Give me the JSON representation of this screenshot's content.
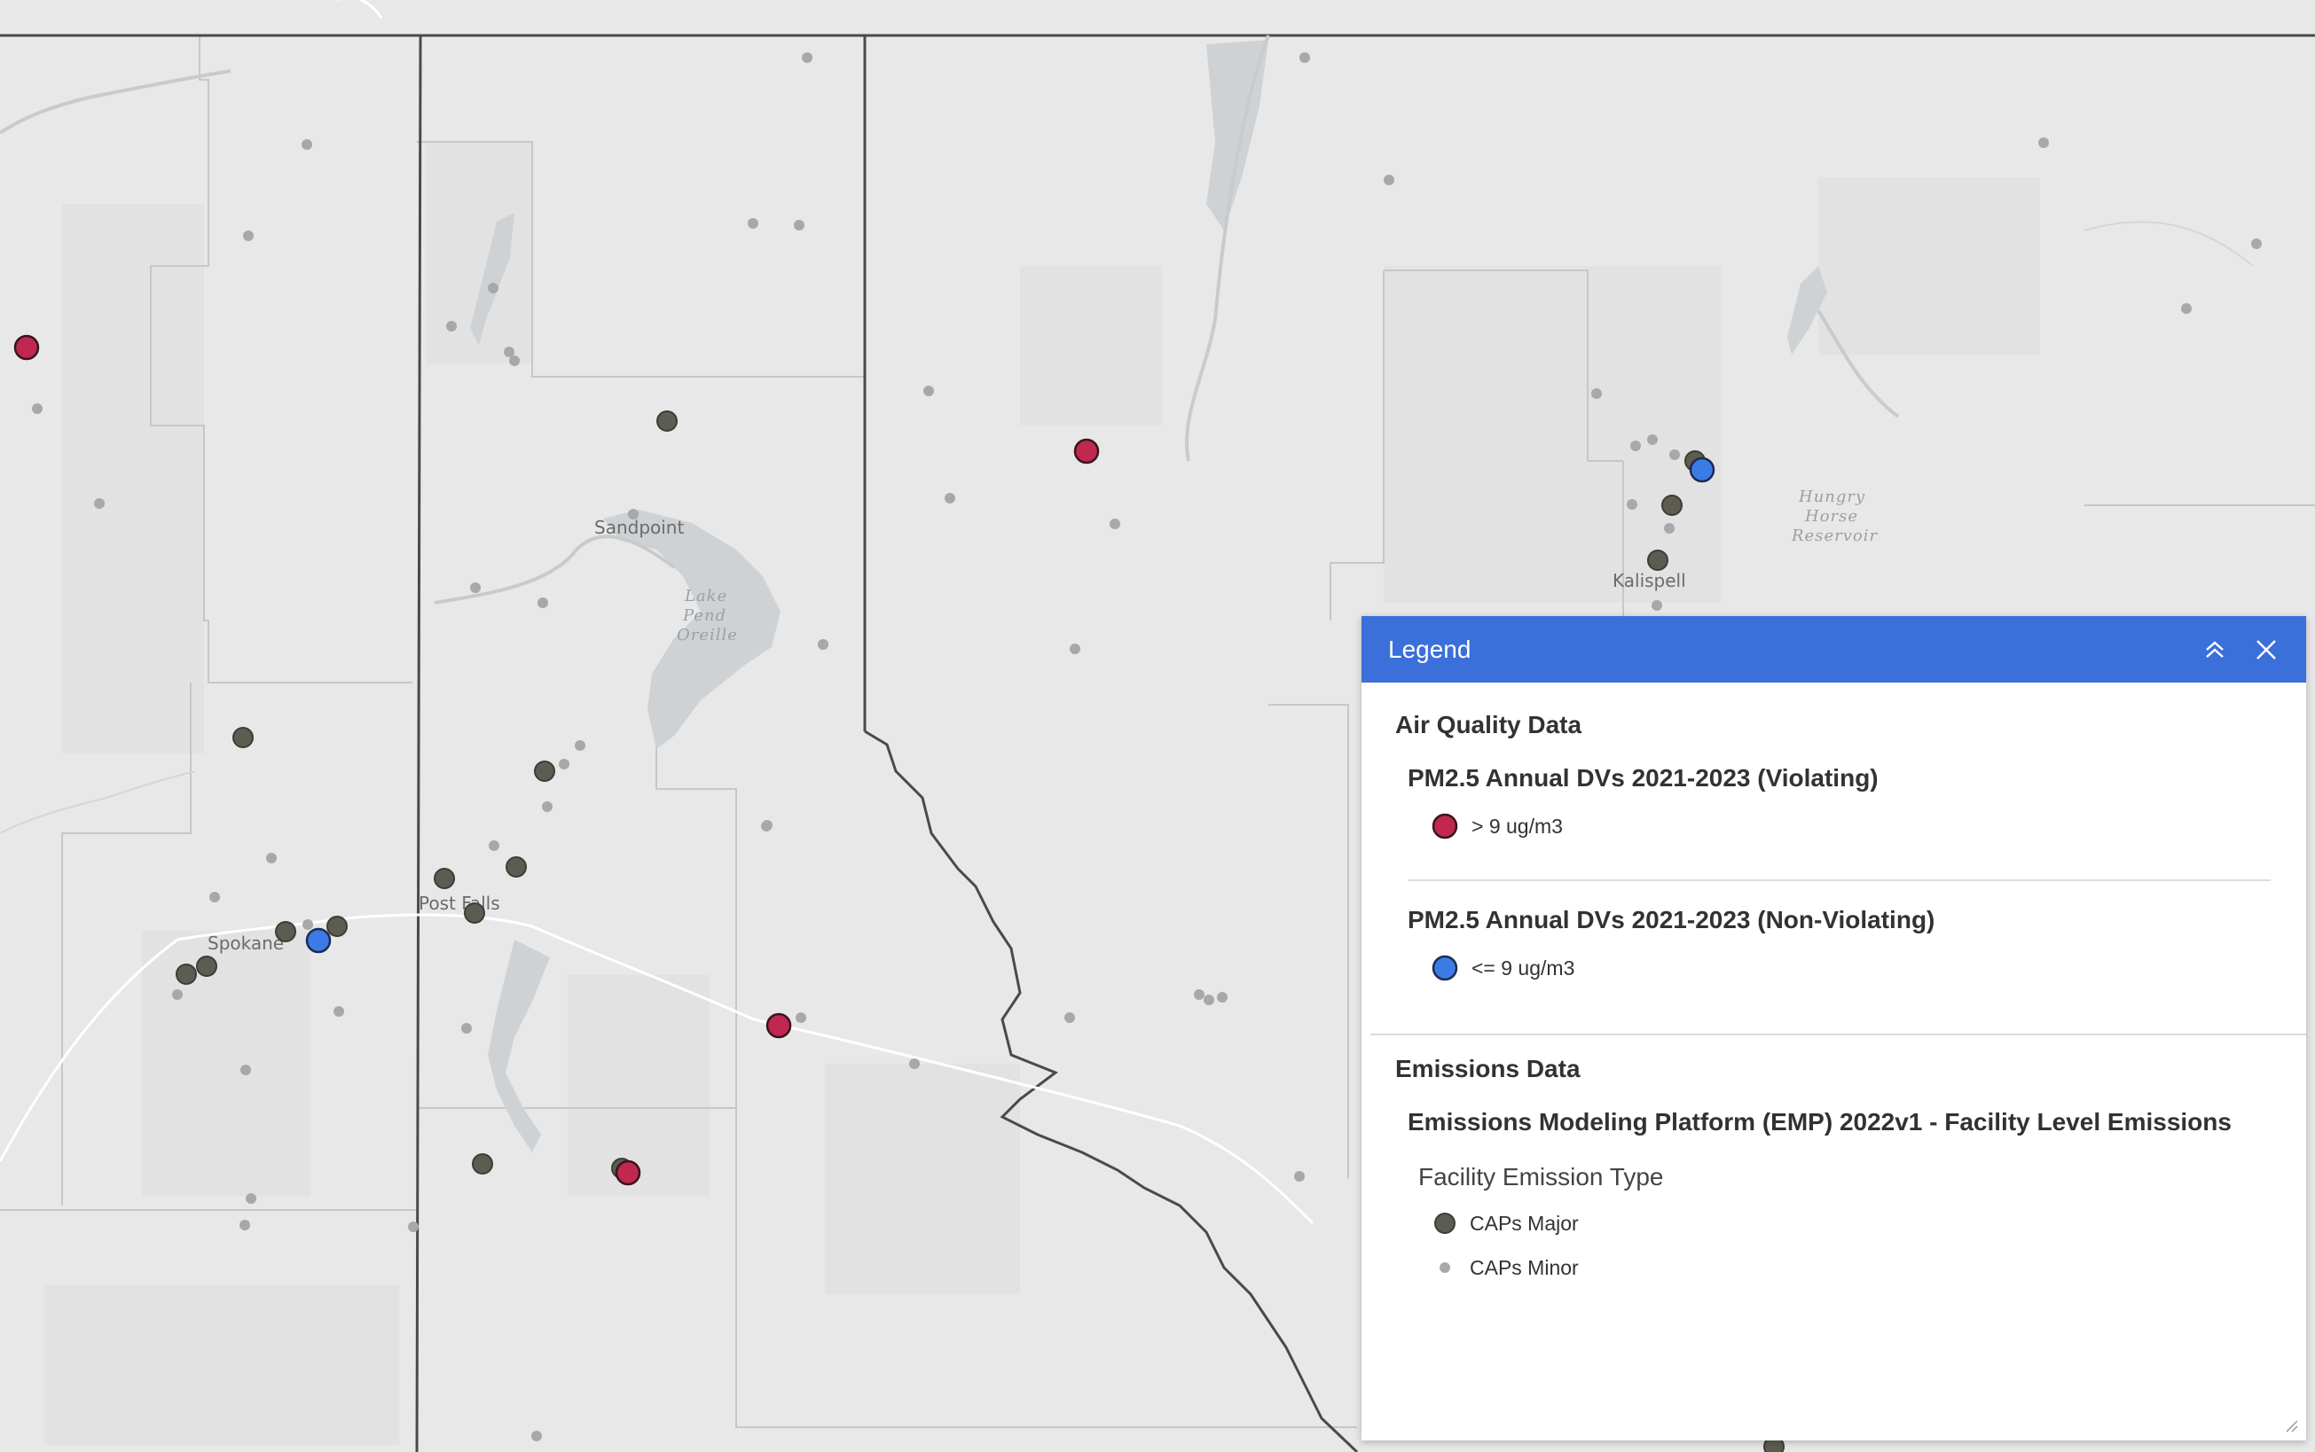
{
  "map": {
    "places": [
      "Sandpoint",
      "Post Falls",
      "Spokane",
      "Kalispell"
    ],
    "water_labels": {
      "lake_pend_oreille": [
        "Lake",
        "Pend",
        "Oreille"
      ],
      "hungry_horse": [
        "Hungry",
        "Horse",
        "Reservoir"
      ]
    }
  },
  "legend": {
    "title": "Legend",
    "sections": {
      "air_quality": {
        "title": "Air Quality Data",
        "violating": {
          "title": "PM2.5 Annual DVs 2021-2023 (Violating)",
          "label": "> 9 ug/m3",
          "color": "#c0284f"
        },
        "non_violating": {
          "title": "PM2.5 Annual DVs 2021-2023 (Non-Violating)",
          "label": "<= 9 ug/m3",
          "color": "#3c7be6"
        }
      },
      "emissions": {
        "title": "Emissions Data",
        "layer_title": "Emissions Modeling Platform (EMP) 2022v1 - Facility Level Emissions",
        "field_title": "Facility Emission Type",
        "major": {
          "label": "CAPs Major",
          "color": "#5c5c52"
        },
        "minor": {
          "label": "CAPs Minor",
          "color": "#a8a8a8"
        }
      }
    },
    "icons": [
      "collapse-icon",
      "close-icon",
      "resize-grip-icon"
    ]
  }
}
